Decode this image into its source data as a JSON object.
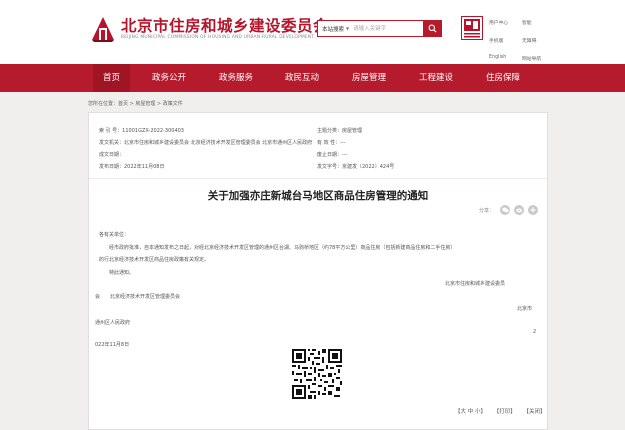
{
  "header": {
    "site_title": "北京市住房和城乡建设委员会",
    "site_subtitle": "BEIJING MUNICIPAL COMMISSION OF HOUSING AND URBAN-RURAL DEVELOPMENT",
    "search": {
      "scope": "本站搜索",
      "placeholder": "请输入关键字"
    },
    "top_links": [
      "用户中心",
      "智能",
      "手机版",
      "无障碍",
      "English",
      "网站导航"
    ]
  },
  "nav": {
    "items": [
      "首页",
      "政务公开",
      "政务服务",
      "政民互动",
      "房屋管理",
      "工程建设",
      "住房保障"
    ]
  },
  "breadcrumb": "您所在位置：首页 > 房屋管理 > 政策文件",
  "meta": {
    "index_no": "索 引 号：11001GZX-2022-300403",
    "agency": "发文机关：北京市住房和城乡建设委员会  北京经济技术开发区管理委员会  北京市通州区人民政府",
    "date_created": "成文日期：",
    "date_published": "发布日期：2022年11月08日",
    "category": "主题分类：房屋管理",
    "validity": "有 效 性：---",
    "abolish_date": "废止日期：---",
    "doc_no": "发文字号：京建发〔2022〕424号"
  },
  "doc": {
    "title": "关于加强亦庄新城台马地区商品住房管理的通知",
    "share_label": "分享：",
    "salutation": "各有关单位：",
    "para1": "　　经市政府批准，自本通知发布之日起，对经北京经济技术开发区管理的通州区台湖、马驹桥地区（约78平方公里）商品住房（包括新建商品住房和二手住房）",
    "para2": "的行北京经济技术开发区商品住房政策有关规定。",
    "para3": "　　特此通知。",
    "issuer1": "北京市住房和城乡建设委员",
    "cc": "会　　北京经济技术开发区管理委员会",
    "issuer_city": "北京市",
    "issuer2": "通州区人民政府",
    "page_num": "2",
    "sign_date": "022年11月8日",
    "footer": [
      "【大 中 小】",
      "【打印】",
      "【关闭】"
    ]
  },
  "colors": {
    "brand_red": "#b51b2c",
    "nav_red": "#b51b2c",
    "title_red": "#b7132a"
  },
  "icons": [
    "building-logo-icon",
    "search-icon",
    "portal-logo-icon",
    "wechat-icon",
    "weibo-icon",
    "share-plus-icon",
    "qr-code-icon"
  ]
}
